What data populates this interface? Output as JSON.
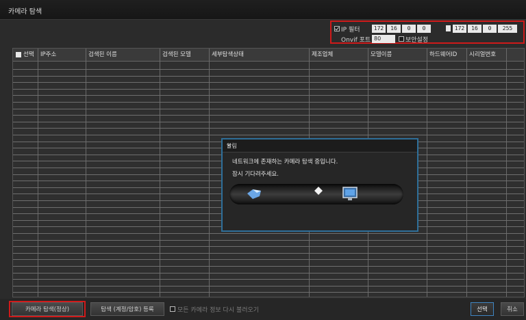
{
  "window": {
    "title": "카메라 탐색"
  },
  "filter": {
    "ip_filter_label": "IP 필터",
    "ip_start": [
      "172",
      "16",
      "0",
      "0"
    ],
    "ip_end": [
      "172",
      "16",
      "0",
      "255"
    ],
    "onvif_port_label": "Onvif 포트",
    "onvif_port_value": "80",
    "secure_label": "보안설정",
    "ip_filter_checked": true,
    "secure_checked": false
  },
  "table": {
    "columns": [
      "선택",
      "IP주소",
      "검색된 이름",
      "검색된 모델",
      "세부탐색상태",
      "제조업체",
      "모델이름",
      "하드웨어ID",
      "시리얼번호"
    ],
    "rows": []
  },
  "dialog": {
    "title": "알림",
    "close_glyph": "×",
    "line1": "네트워크에 존재하는 카메라 탐색 중입니다.",
    "line2": "잠시 기다려주세요."
  },
  "footer": {
    "search_button": "카메라 탐색(정상)",
    "register_button": "탐색 (계정/암호) 등록",
    "reload_label": "모든 카메라 정보 다시 불러오기",
    "ok_button": "선택",
    "cancel_button": "취소"
  },
  "colors": {
    "highlight": "#d01a1a",
    "dialog_border": "#2e6f9a"
  }
}
